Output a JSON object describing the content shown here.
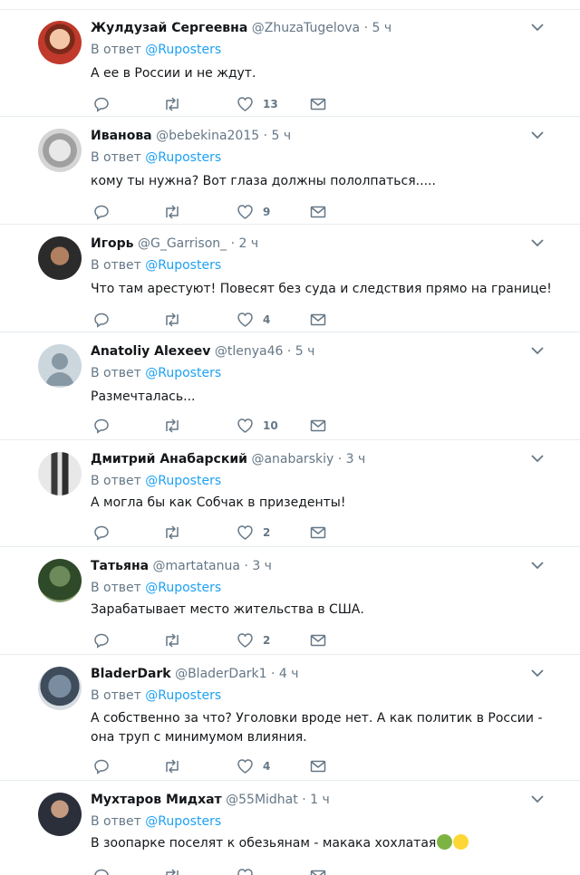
{
  "reply_prefix": "В ответ",
  "tweets": [
    {
      "name": "Жулдузай Сергеевна",
      "handle": "@ZhuzaTugelova",
      "time": "5 ч",
      "mention": "@Ruposters",
      "text": "А ее в России и не ждут.",
      "likes": "13",
      "avatar": "face-woman-red"
    },
    {
      "name": "Иванова",
      "handle": "@bebekina2015",
      "time": "5 ч",
      "mention": "@Ruposters",
      "text": "кому ты нужна? Вот глаза должны пололпаться.....",
      "likes": "9",
      "avatar": "baby-doll-face"
    },
    {
      "name": "Игорь",
      "handle": "@G_Garrison_",
      "time": "2 ч",
      "mention": "@Ruposters",
      "text": "Что там арестуют! Повесят без суда и следствия прямо на границе!",
      "likes": "4",
      "avatar": "man-dark-face"
    },
    {
      "name": "Anatoliy Alexeev",
      "handle": "@tlenya46",
      "time": "5 ч",
      "mention": "@Ruposters",
      "text": "Размечталась...",
      "likes": "10",
      "avatar": "default-silhouette"
    },
    {
      "name": "Дмитрий Анабарский",
      "handle": "@anabarskiy",
      "time": "3 ч",
      "mention": "@Ruposters",
      "text": "А могла бы как Собчак в призеденты!",
      "likes": "2",
      "avatar": "two-men-photo"
    },
    {
      "name": "Татьяна",
      "handle": "@martatanua",
      "time": "3 ч",
      "mention": "@Ruposters",
      "text": "Зарабатывает место жительства в США.",
      "likes": "2",
      "avatar": "woman-in-trees"
    },
    {
      "name": "BladerDark",
      "handle": "@BladerDark1",
      "time": "4 ч",
      "mention": "@Ruposters",
      "text": "А собственно за что? Уголовки вроде нет. А как политик в России - она труп с минимумом влияния.",
      "likes": "4",
      "avatar": "robot-figure"
    },
    {
      "name": "Мухтаров Мидхат",
      "handle": "@55Midhat",
      "time": "1 ч",
      "mention": "@Ruposters",
      "text": "В зоопарке поселят к обезьянам - макака хохлатая",
      "likes": "",
      "avatar": "man-in-suit",
      "emojis": [
        "nauseated-face-emoji",
        "grimacing-face-emoji"
      ]
    }
  ]
}
